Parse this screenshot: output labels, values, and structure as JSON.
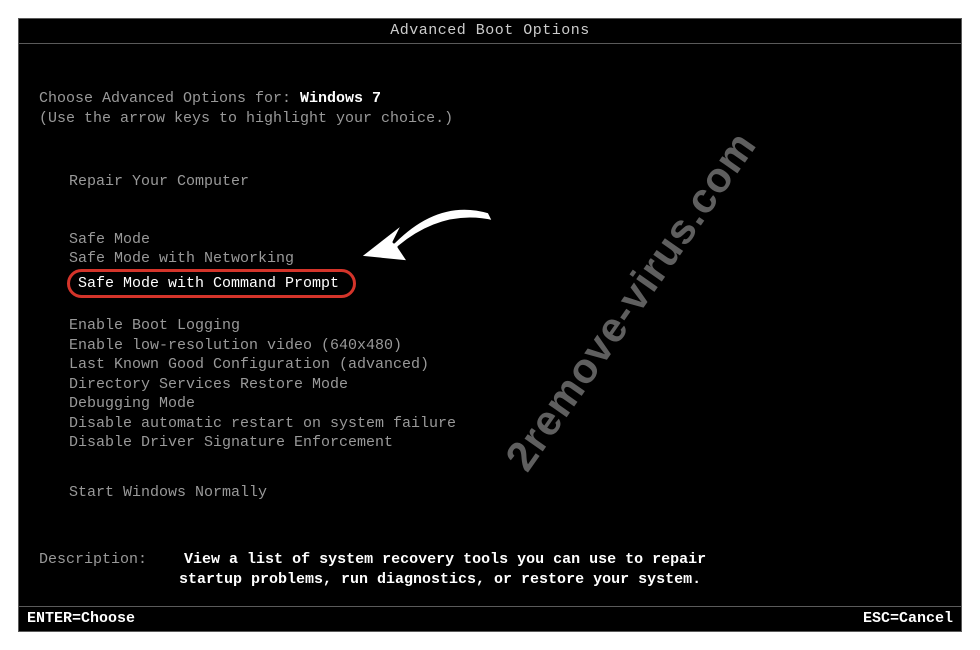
{
  "title": "Advanced Boot Options",
  "intro_prefix": "Choose Advanced Options for: ",
  "os_name": "Windows 7",
  "hint": "(Use the arrow keys to highlight your choice.)",
  "options": {
    "repair": "Repair Your Computer",
    "safe": "Safe Mode",
    "safe_net": "Safe Mode with Networking",
    "safe_cmd": "Safe Mode with Command Prompt",
    "boot_log": "Enable Boot Logging",
    "low_res": "Enable low-resolution video (640x480)",
    "lkgc": "Last Known Good Configuration (advanced)",
    "dsrm": "Directory Services Restore Mode",
    "debug": "Debugging Mode",
    "no_auto_restart": "Disable automatic restart on system failure",
    "no_driver_sig": "Disable Driver Signature Enforcement",
    "normal": "Start Windows Normally"
  },
  "description": {
    "label": "Description:",
    "line1": "View a list of system recovery tools you can use to repair",
    "line2": "startup problems, run diagnostics, or restore your system."
  },
  "footer": {
    "enter": "ENTER=Choose",
    "esc": "ESC=Cancel"
  },
  "watermark": "2remove-virus.com"
}
